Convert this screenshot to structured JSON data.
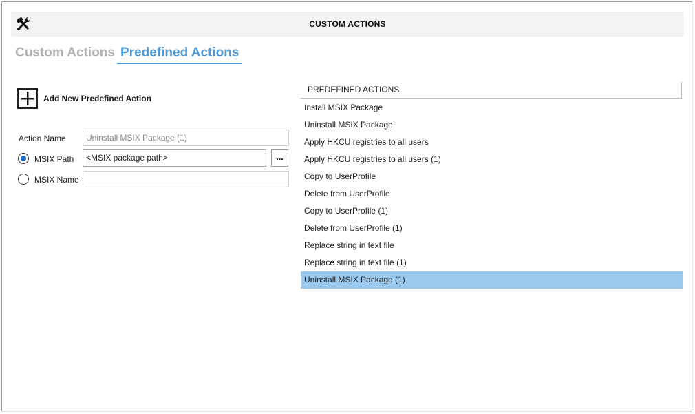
{
  "header": {
    "title": "CUSTOM ACTIONS",
    "icon": "tools-icon"
  },
  "tabs": [
    {
      "label": "Custom Actions",
      "active": false
    },
    {
      "label": "Predefined Actions",
      "active": true
    }
  ],
  "add_button": {
    "label": "Add New Predefined Action",
    "icon": "plus-icon"
  },
  "form": {
    "action_name": {
      "label": "Action Name",
      "value": "Uninstall MSIX Package (1)"
    },
    "msix_path": {
      "label": "MSIX Path",
      "value": "<MSIX package path>",
      "selected": true,
      "browse_label": "..."
    },
    "msix_name": {
      "label": "MSIX Name",
      "value": "",
      "selected": false
    }
  },
  "list": {
    "header": "PREDEFINED ACTIONS",
    "items": [
      "Install MSIX Package",
      "Uninstall MSIX Package",
      "Apply HKCU registries to all users",
      "Apply HKCU registries to all users (1)",
      "Copy to UserProfile",
      "Delete from UserProfile",
      "Copy to UserProfile (1)",
      "Delete from UserProfile (1)",
      "Replace string in text file",
      "Replace string in text file (1)",
      "Uninstall MSIX Package (1)"
    ],
    "selected_index": 10,
    "selected_color": "#99c9ef"
  },
  "accent_color": "#4e9ad9"
}
